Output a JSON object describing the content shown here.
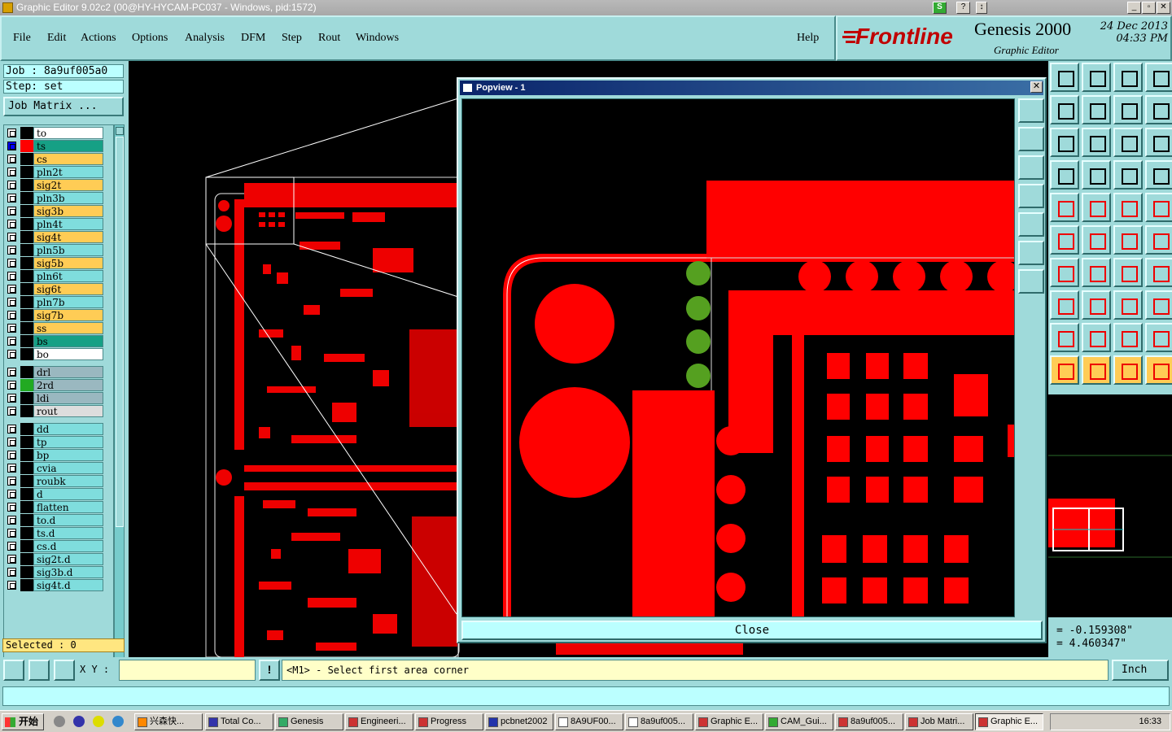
{
  "window": {
    "title": "Graphic Editor 9.02c2 (00@HY-HYCAM-PC037 - Windows, pid:1572)"
  },
  "menu": [
    "File",
    "Edit",
    "Actions",
    "Options",
    "Analysis",
    "DFM",
    "Step",
    "Rout",
    "Windows"
  ],
  "help_label": "Help",
  "brand": {
    "logo": "Frontline",
    "product": "Genesis 2000",
    "subtitle": "Graphic Editor",
    "date": "24 Dec 2013",
    "time": "04:33 PM"
  },
  "job": {
    "label": "Job : 8a9uf005a0",
    "step": "Step: set",
    "matrix_button": "Job Matrix ..."
  },
  "layers": [
    {
      "name": "to",
      "color": "#ffffff",
      "swatch": "#000000"
    },
    {
      "name": "ts",
      "color": "#16a085",
      "swatch": "#ff0000",
      "selected": true
    },
    {
      "name": "cs",
      "color": "#ffcc55",
      "swatch": "#000000"
    },
    {
      "name": "pln2t",
      "color": "#7fdddd",
      "swatch": "#000000"
    },
    {
      "name": "sig2t",
      "color": "#ffcc55",
      "swatch": "#000000"
    },
    {
      "name": "pln3b",
      "color": "#7fdddd",
      "swatch": "#000000"
    },
    {
      "name": "sig3b",
      "color": "#ffcc55",
      "swatch": "#000000"
    },
    {
      "name": "pln4t",
      "color": "#7fdddd",
      "swatch": "#000000"
    },
    {
      "name": "sig4t",
      "color": "#ffcc55",
      "swatch": "#000000"
    },
    {
      "name": "pln5b",
      "color": "#7fdddd",
      "swatch": "#000000"
    },
    {
      "name": "sig5b",
      "color": "#ffcc55",
      "swatch": "#000000"
    },
    {
      "name": "pln6t",
      "color": "#7fdddd",
      "swatch": "#000000"
    },
    {
      "name": "sig6t",
      "color": "#ffcc55",
      "swatch": "#000000"
    },
    {
      "name": "pln7b",
      "color": "#7fdddd",
      "swatch": "#000000"
    },
    {
      "name": "sig7b",
      "color": "#ffcc55",
      "swatch": "#000000"
    },
    {
      "name": "ss",
      "color": "#ffcc55",
      "swatch": "#000000"
    },
    {
      "name": "bs",
      "color": "#16a085",
      "swatch": "#000000"
    },
    {
      "name": "bo",
      "color": "#ffffff",
      "swatch": "#000000"
    },
    {
      "name": "drl",
      "color": "#9ab8c0",
      "swatch": "#000000"
    },
    {
      "name": "2rd",
      "color": "#9ab8c0",
      "swatch": "#22aa22"
    },
    {
      "name": "ldi",
      "color": "#9ab8c0",
      "swatch": "#000000"
    },
    {
      "name": "rout",
      "color": "#dddddd",
      "swatch": "#000000"
    },
    {
      "name": "dd",
      "color": "#7fdddd",
      "swatch": "#000000"
    },
    {
      "name": "tp",
      "color": "#7fdddd",
      "swatch": "#000000"
    },
    {
      "name": "bp",
      "color": "#7fdddd",
      "swatch": "#000000"
    },
    {
      "name": "cvia",
      "color": "#7fdddd",
      "swatch": "#000000"
    },
    {
      "name": "roubk",
      "color": "#7fdddd",
      "swatch": "#000000"
    },
    {
      "name": "d",
      "color": "#7fdddd",
      "swatch": "#000000"
    },
    {
      "name": "flatten",
      "color": "#7fdddd",
      "swatch": "#000000"
    },
    {
      "name": "to.d",
      "color": "#7fdddd",
      "swatch": "#000000"
    },
    {
      "name": "ts.d",
      "color": "#7fdddd",
      "swatch": "#000000"
    },
    {
      "name": "cs.d",
      "color": "#7fdddd",
      "swatch": "#000000"
    },
    {
      "name": "sig2t.d",
      "color": "#7fdddd",
      "swatch": "#000000"
    },
    {
      "name": "sig3b.d",
      "color": "#7fdddd",
      "swatch": "#000000"
    },
    {
      "name": "sig4t.d",
      "color": "#7fdddd",
      "swatch": "#000000"
    }
  ],
  "selected": "Selected : 0",
  "popview": {
    "title": "Popview - 1",
    "close_label": "Close"
  },
  "coords": {
    "x": "= -0.159308\"",
    "y": "= 4.460347\""
  },
  "command": {
    "xy_label": "X Y :",
    "xy_value": "",
    "prompt": "<M1> - Select first area corner",
    "unit": "Inch"
  },
  "taskbar": {
    "start": "开始",
    "tasks": [
      "兴森快...",
      "Total Co...",
      "Genesis",
      "Engineeri...",
      "Progress",
      "pcbnet2002",
      "8A9UF00...",
      "8a9uf005...",
      "Graphic E...",
      "CAM_Gui...",
      "8a9uf005...",
      "Job Matri...",
      "Graphic E..."
    ],
    "clock": "16:33"
  },
  "colors": {
    "panel": "#9fdada",
    "copper": "#ff0000",
    "pad": "#55a020"
  }
}
